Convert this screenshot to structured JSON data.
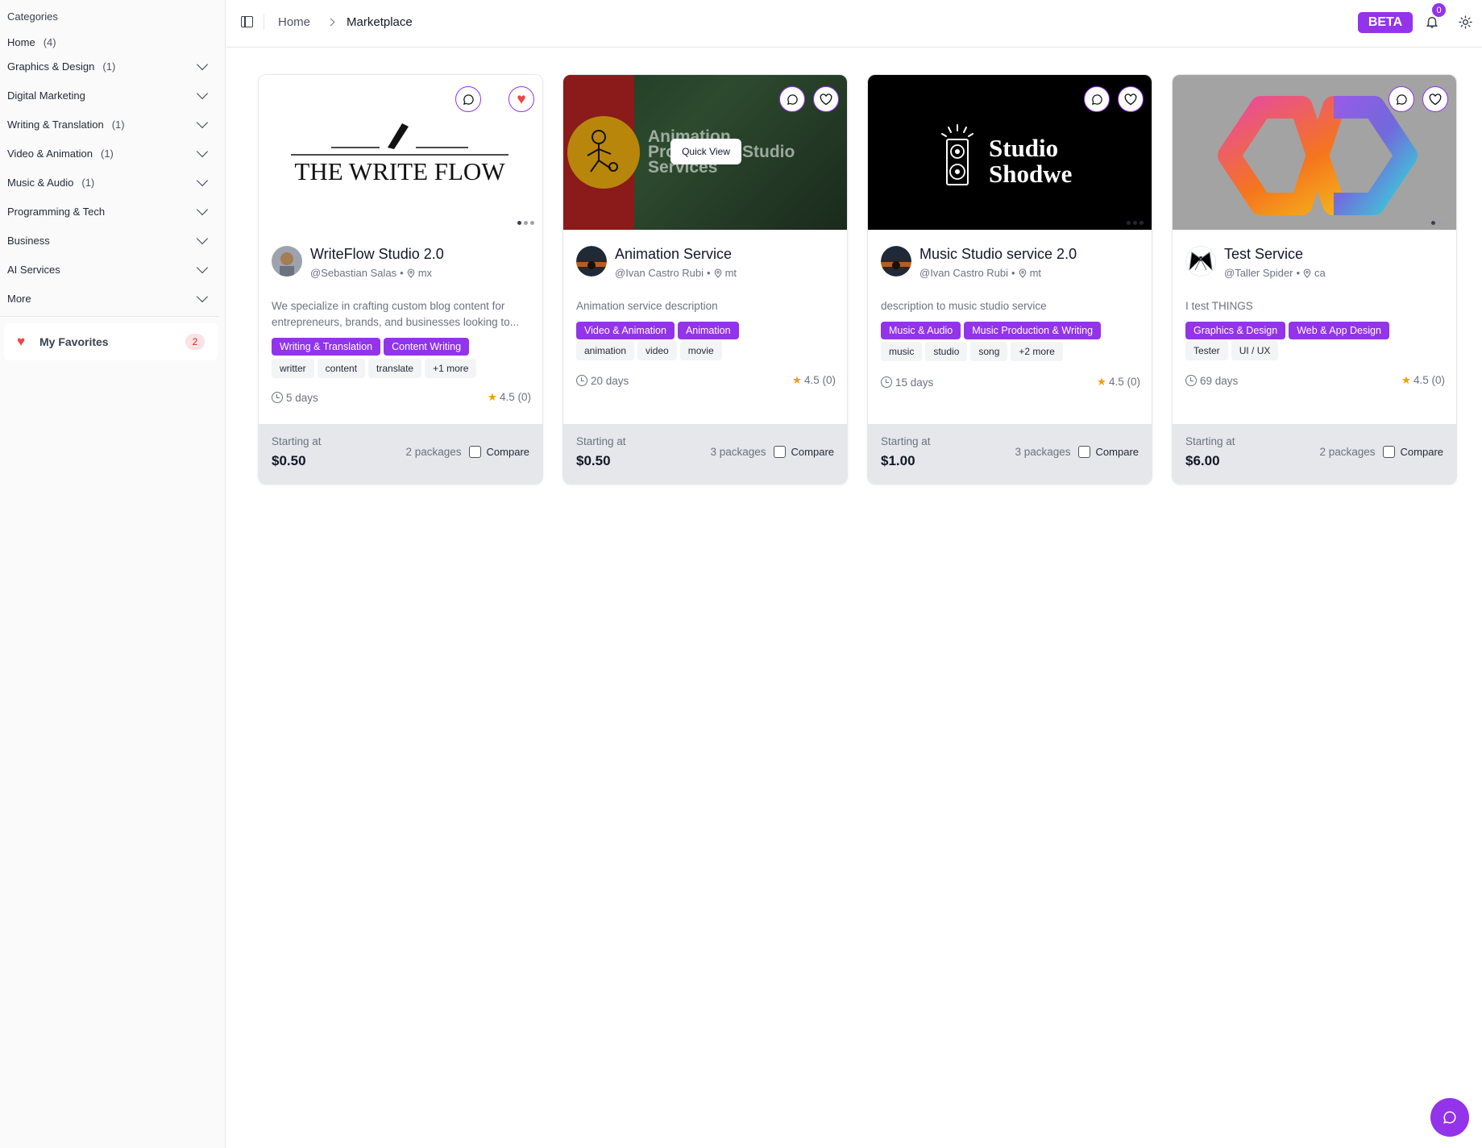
{
  "sidebar": {
    "title": "Categories",
    "items": [
      {
        "label": "Home",
        "count": "(4)"
      },
      {
        "label": "Graphics & Design",
        "count": "(1)"
      },
      {
        "label": "Digital Marketing",
        "count": ""
      },
      {
        "label": "Writing & Translation",
        "count": "(1)"
      },
      {
        "label": "Video & Animation",
        "count": "(1)"
      },
      {
        "label": "Music & Audio",
        "count": "(1)"
      },
      {
        "label": "Programming & Tech",
        "count": ""
      },
      {
        "label": "Business",
        "count": ""
      },
      {
        "label": "AI Services",
        "count": ""
      },
      {
        "label": "More",
        "count": ""
      }
    ],
    "favorites": {
      "label": "My Favorites",
      "count": "2"
    }
  },
  "header": {
    "breadcrumb_home": "Home",
    "breadcrumb_current": "Marketplace",
    "beta": "BETA",
    "notifications": "0"
  },
  "colors": {
    "accent": "#9333ea",
    "heart": "#ef4444",
    "star": "#f59e0b"
  },
  "cards": [
    {
      "title": "WriteFlow Studio 2.0",
      "seller": "@Sebastian Salas",
      "location": "mx",
      "description": "We specialize in crafting custom blog content for entrepreneurs, brands, and businesses looking to...",
      "categories": [
        "Writing & Translation",
        "Content Writing"
      ],
      "tags": [
        "writter",
        "content",
        "translate",
        "+1 more"
      ],
      "delivery": "5 days",
      "rating": "4.5 (0)",
      "starting_label": "Starting at",
      "price": "$0.50",
      "packages": "2 packages",
      "compare": "Compare",
      "logo_text": "THE WRITE FLOW",
      "favorited": true
    },
    {
      "title": "Animation Service",
      "seller": "@Ivan Castro Rubi",
      "location": "mt",
      "description": "Animation service description",
      "categories": [
        "Video & Animation",
        "Animation"
      ],
      "tags": [
        "animation",
        "video",
        "movie"
      ],
      "delivery": "20 days",
      "rating": "4.5 (0)",
      "starting_label": "Starting at",
      "price": "$0.50",
      "packages": "3 packages",
      "compare": "Compare",
      "banner_line1": "Animation",
      "banner_line2": "Pro",
      "banner_line2b": "Studio",
      "banner_line3": "Services",
      "quick_view": "Quick View"
    },
    {
      "title": "Music Studio service 2.0",
      "seller": "@Ivan Castro Rubi",
      "location": "mt",
      "description": "description to music studio service",
      "categories": [
        "Music & Audio",
        "Music Production & Writing"
      ],
      "tags": [
        "music",
        "studio",
        "song",
        "+2 more"
      ],
      "delivery": "15 days",
      "rating": "4.5 (0)",
      "starting_label": "Starting at",
      "price": "$1.00",
      "packages": "3 packages",
      "compare": "Compare",
      "logo_line1": "Studio",
      "logo_line2": "Shodwe"
    },
    {
      "title": "Test Service",
      "seller": "@Taller Spider",
      "location": "ca",
      "description": "I test THINGS",
      "categories": [
        "Graphics & Design",
        "Web & App Design"
      ],
      "tags": [
        "Tester",
        "UI / UX"
      ],
      "delivery": "69 days",
      "rating": "4.5 (0)",
      "starting_label": "Starting at",
      "price": "$6.00",
      "packages": "2 packages",
      "compare": "Compare"
    }
  ]
}
